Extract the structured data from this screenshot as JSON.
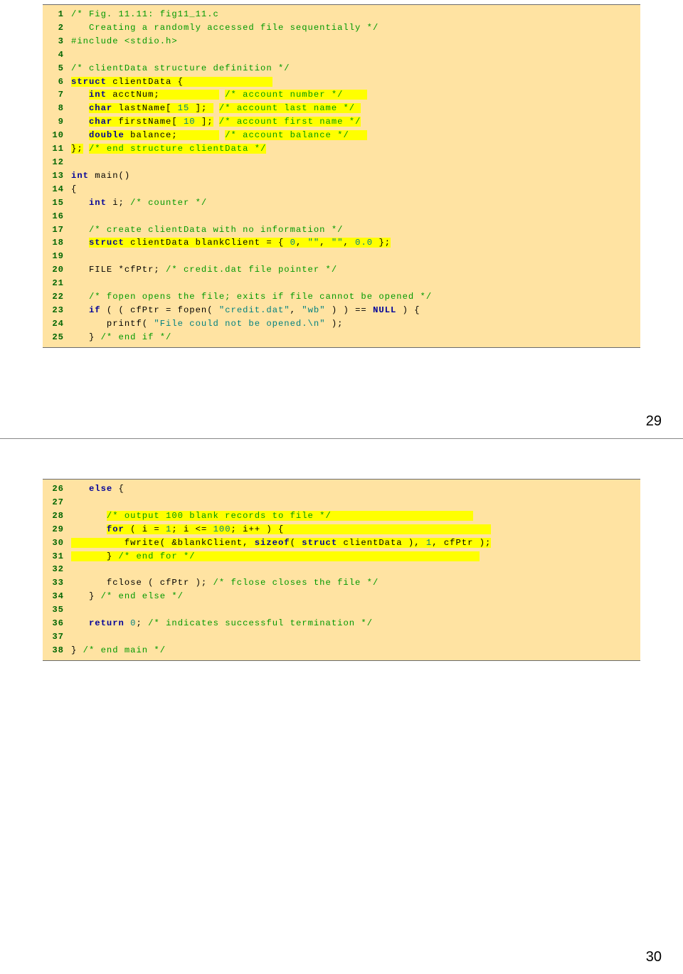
{
  "pages": {
    "p1": "29",
    "p2": "30"
  },
  "block1": [
    {
      "n": "1",
      "segs": [
        {
          "cls": "c-comment",
          "t": "/* Fig. 11.11: fig11_11.c"
        }
      ]
    },
    {
      "n": "2",
      "segs": [
        {
          "cls": "c-comment",
          "t": "   Creating a randomly accessed file sequentially */"
        }
      ]
    },
    {
      "n": "3",
      "segs": [
        {
          "cls": "c-inc",
          "t": "#include "
        },
        {
          "cls": "c-inc",
          "t": "<stdio.h>"
        }
      ]
    },
    {
      "n": "4",
      "segs": [
        {
          "cls": "c-text",
          "t": ""
        }
      ]
    },
    {
      "n": "5",
      "segs": [
        {
          "cls": "c-comment",
          "t": "/* clientData structure definition */"
        }
      ]
    },
    {
      "n": "6",
      "segs": [
        {
          "cls": "c-kw",
          "t": "struct",
          "hl": true
        },
        {
          "cls": "c-text",
          "t": " clientData {               ",
          "hl": true
        },
        {
          "cls": "c-text",
          "t": "                    "
        }
      ]
    },
    {
      "n": "7",
      "segs": [
        {
          "cls": "c-text",
          "t": "   "
        },
        {
          "cls": "c-kw",
          "t": "int",
          "hl": true
        },
        {
          "cls": "c-text",
          "t": " acctNum;          ",
          "hl": true
        },
        {
          "cls": "c-text",
          "t": " "
        },
        {
          "cls": "c-comment",
          "t": "/* account number */    ",
          "hl": true
        }
      ]
    },
    {
      "n": "8",
      "segs": [
        {
          "cls": "c-text",
          "t": "   "
        },
        {
          "cls": "c-kw",
          "t": "char",
          "hl": true
        },
        {
          "cls": "c-text",
          "t": " lastName[ ",
          "hl": true
        },
        {
          "cls": "c-num",
          "t": "15",
          "hl": true
        },
        {
          "cls": "c-text",
          "t": " ]; ",
          "hl": true
        },
        {
          "cls": "c-text",
          "t": " "
        },
        {
          "cls": "c-comment",
          "t": "/* account last name */ ",
          "hl": true
        }
      ]
    },
    {
      "n": "9",
      "segs": [
        {
          "cls": "c-text",
          "t": "   "
        },
        {
          "cls": "c-kw",
          "t": "char",
          "hl": true
        },
        {
          "cls": "c-text",
          "t": " firstName[ ",
          "hl": true
        },
        {
          "cls": "c-num",
          "t": "10",
          "hl": true
        },
        {
          "cls": "c-text",
          "t": " ];",
          "hl": true
        },
        {
          "cls": "c-text",
          "t": " "
        },
        {
          "cls": "c-comment",
          "t": "/* account first name */",
          "hl": true
        }
      ]
    },
    {
      "n": "10",
      "segs": [
        {
          "cls": "c-text",
          "t": "   "
        },
        {
          "cls": "c-kw",
          "t": "double",
          "hl": true
        },
        {
          "cls": "c-text",
          "t": " balance;       ",
          "hl": true
        },
        {
          "cls": "c-text",
          "t": " "
        },
        {
          "cls": "c-comment",
          "t": "/* account balance */   ",
          "hl": true
        }
      ]
    },
    {
      "n": "11",
      "segs": [
        {
          "cls": "c-text",
          "t": "};",
          "hl": true
        },
        {
          "cls": "c-text",
          "t": " "
        },
        {
          "cls": "c-comment",
          "t": "/* end structure clientData */",
          "hl": true
        }
      ]
    },
    {
      "n": "12",
      "segs": [
        {
          "cls": "c-text",
          "t": ""
        }
      ]
    },
    {
      "n": "13",
      "segs": [
        {
          "cls": "c-kw",
          "t": "int"
        },
        {
          "cls": "c-text",
          "t": " main()"
        }
      ]
    },
    {
      "n": "14",
      "segs": [
        {
          "cls": "c-text",
          "t": "{"
        }
      ]
    },
    {
      "n": "15",
      "segs": [
        {
          "cls": "c-text",
          "t": "   "
        },
        {
          "cls": "c-kw",
          "t": "int"
        },
        {
          "cls": "c-text",
          "t": " i; "
        },
        {
          "cls": "c-comment",
          "t": "/* counter */"
        }
      ]
    },
    {
      "n": "16",
      "segs": [
        {
          "cls": "c-text",
          "t": ""
        }
      ]
    },
    {
      "n": "17",
      "segs": [
        {
          "cls": "c-text",
          "t": "   "
        },
        {
          "cls": "c-comment",
          "t": "/* create clientData with no information */"
        }
      ]
    },
    {
      "n": "18",
      "segs": [
        {
          "cls": "c-text",
          "t": "   "
        },
        {
          "cls": "c-kw",
          "t": "struct",
          "hl": true
        },
        {
          "cls": "c-text",
          "t": " clientData blankClient = { ",
          "hl": true
        },
        {
          "cls": "c-num",
          "t": "0",
          "hl": true
        },
        {
          "cls": "c-text",
          "t": ", ",
          "hl": true
        },
        {
          "cls": "c-str",
          "t": "\"\"",
          "hl": true
        },
        {
          "cls": "c-text",
          "t": ", ",
          "hl": true
        },
        {
          "cls": "c-str",
          "t": "\"\"",
          "hl": true
        },
        {
          "cls": "c-text",
          "t": ", ",
          "hl": true
        },
        {
          "cls": "c-num",
          "t": "0.0",
          "hl": true
        },
        {
          "cls": "c-text",
          "t": " };",
          "hl": true
        }
      ]
    },
    {
      "n": "19",
      "segs": [
        {
          "cls": "c-text",
          "t": " "
        }
      ]
    },
    {
      "n": "20",
      "segs": [
        {
          "cls": "c-text",
          "t": "   FILE *cfPtr; "
        },
        {
          "cls": "c-comment",
          "t": "/* credit.dat file pointer */"
        }
      ]
    },
    {
      "n": "21",
      "segs": [
        {
          "cls": "c-text",
          "t": ""
        }
      ]
    },
    {
      "n": "22",
      "segs": [
        {
          "cls": "c-text",
          "t": "   "
        },
        {
          "cls": "c-comment",
          "t": "/* fopen opens the file; exits if file cannot be opened */"
        }
      ]
    },
    {
      "n": "23",
      "segs": [
        {
          "cls": "c-text",
          "t": "   "
        },
        {
          "cls": "c-kw",
          "t": "if"
        },
        {
          "cls": "c-text",
          "t": " ( ( cfPtr = fopen( "
        },
        {
          "cls": "c-str",
          "t": "\"credit.dat\""
        },
        {
          "cls": "c-text",
          "t": ", "
        },
        {
          "cls": "c-str",
          "t": "\"wb\""
        },
        {
          "cls": "c-text",
          "t": " ) ) == "
        },
        {
          "cls": "c-kw",
          "t": "NULL"
        },
        {
          "cls": "c-text",
          "t": " ) {"
        }
      ]
    },
    {
      "n": "24",
      "segs": [
        {
          "cls": "c-text",
          "t": "      printf( "
        },
        {
          "cls": "c-str",
          "t": "\"File could not be opened.\\n\""
        },
        {
          "cls": "c-text",
          "t": " );"
        }
      ]
    },
    {
      "n": "25",
      "segs": [
        {
          "cls": "c-text",
          "t": "   } "
        },
        {
          "cls": "c-comment",
          "t": "/* end if */"
        }
      ]
    }
  ],
  "block2": [
    {
      "n": "26",
      "segs": [
        {
          "cls": "c-text",
          "t": "   "
        },
        {
          "cls": "c-kw",
          "t": "else"
        },
        {
          "cls": "c-text",
          "t": " { "
        }
      ]
    },
    {
      "n": "27",
      "segs": [
        {
          "cls": "c-text",
          "t": " "
        }
      ]
    },
    {
      "n": "28",
      "segs": [
        {
          "cls": "c-text",
          "t": "      "
        },
        {
          "cls": "c-comment",
          "t": "/* output 100 blank records to file */                        ",
          "hl": true
        }
      ]
    },
    {
      "n": "29",
      "segs": [
        {
          "cls": "c-text",
          "t": "      "
        },
        {
          "cls": "c-kw",
          "t": "for",
          "hl": true
        },
        {
          "cls": "c-text",
          "t": " ( i = ",
          "hl": true
        },
        {
          "cls": "c-num",
          "t": "1",
          "hl": true
        },
        {
          "cls": "c-text",
          "t": "; i <= ",
          "hl": true
        },
        {
          "cls": "c-num",
          "t": "100",
          "hl": true
        },
        {
          "cls": "c-text",
          "t": "; i++ ) {                                   ",
          "hl": true
        }
      ]
    },
    {
      "n": "30",
      "segs": [
        {
          "cls": "c-text",
          "t": "         fwrite( &blankClient, ",
          "hl": true
        },
        {
          "cls": "c-kw",
          "t": "sizeof",
          "hl": true
        },
        {
          "cls": "c-text",
          "t": "( ",
          "hl": true
        },
        {
          "cls": "c-kw",
          "t": "struct",
          "hl": true
        },
        {
          "cls": "c-text",
          "t": " clientData ), ",
          "hl": true
        },
        {
          "cls": "c-num",
          "t": "1",
          "hl": true
        },
        {
          "cls": "c-text",
          "t": ", cfPtr );",
          "hl": true
        }
      ]
    },
    {
      "n": "31",
      "segs": [
        {
          "cls": "c-text",
          "t": "      } ",
          "hl": true
        },
        {
          "cls": "c-comment",
          "t": "/* end for */                                                ",
          "hl": true
        }
      ]
    },
    {
      "n": "32",
      "segs": [
        {
          "cls": "c-text",
          "t": ""
        }
      ]
    },
    {
      "n": "33",
      "segs": [
        {
          "cls": "c-text",
          "t": "      fclose ( cfPtr ); "
        },
        {
          "cls": "c-comment",
          "t": "/* fclose closes the file */"
        }
      ]
    },
    {
      "n": "34",
      "segs": [
        {
          "cls": "c-text",
          "t": "   } "
        },
        {
          "cls": "c-comment",
          "t": "/* end else */"
        }
      ]
    },
    {
      "n": "35",
      "segs": [
        {
          "cls": "c-text",
          "t": ""
        }
      ]
    },
    {
      "n": "36",
      "segs": [
        {
          "cls": "c-text",
          "t": "   "
        },
        {
          "cls": "c-kw",
          "t": "return"
        },
        {
          "cls": "c-text",
          "t": " "
        },
        {
          "cls": "c-num",
          "t": "0"
        },
        {
          "cls": "c-text",
          "t": "; "
        },
        {
          "cls": "c-comment",
          "t": "/* indicates successful termination */"
        }
      ]
    },
    {
      "n": "37",
      "segs": [
        {
          "cls": "c-text",
          "t": ""
        }
      ]
    },
    {
      "n": "38",
      "segs": [
        {
          "cls": "c-text",
          "t": "} "
        },
        {
          "cls": "c-comment",
          "t": "/* end main */"
        }
      ]
    }
  ]
}
